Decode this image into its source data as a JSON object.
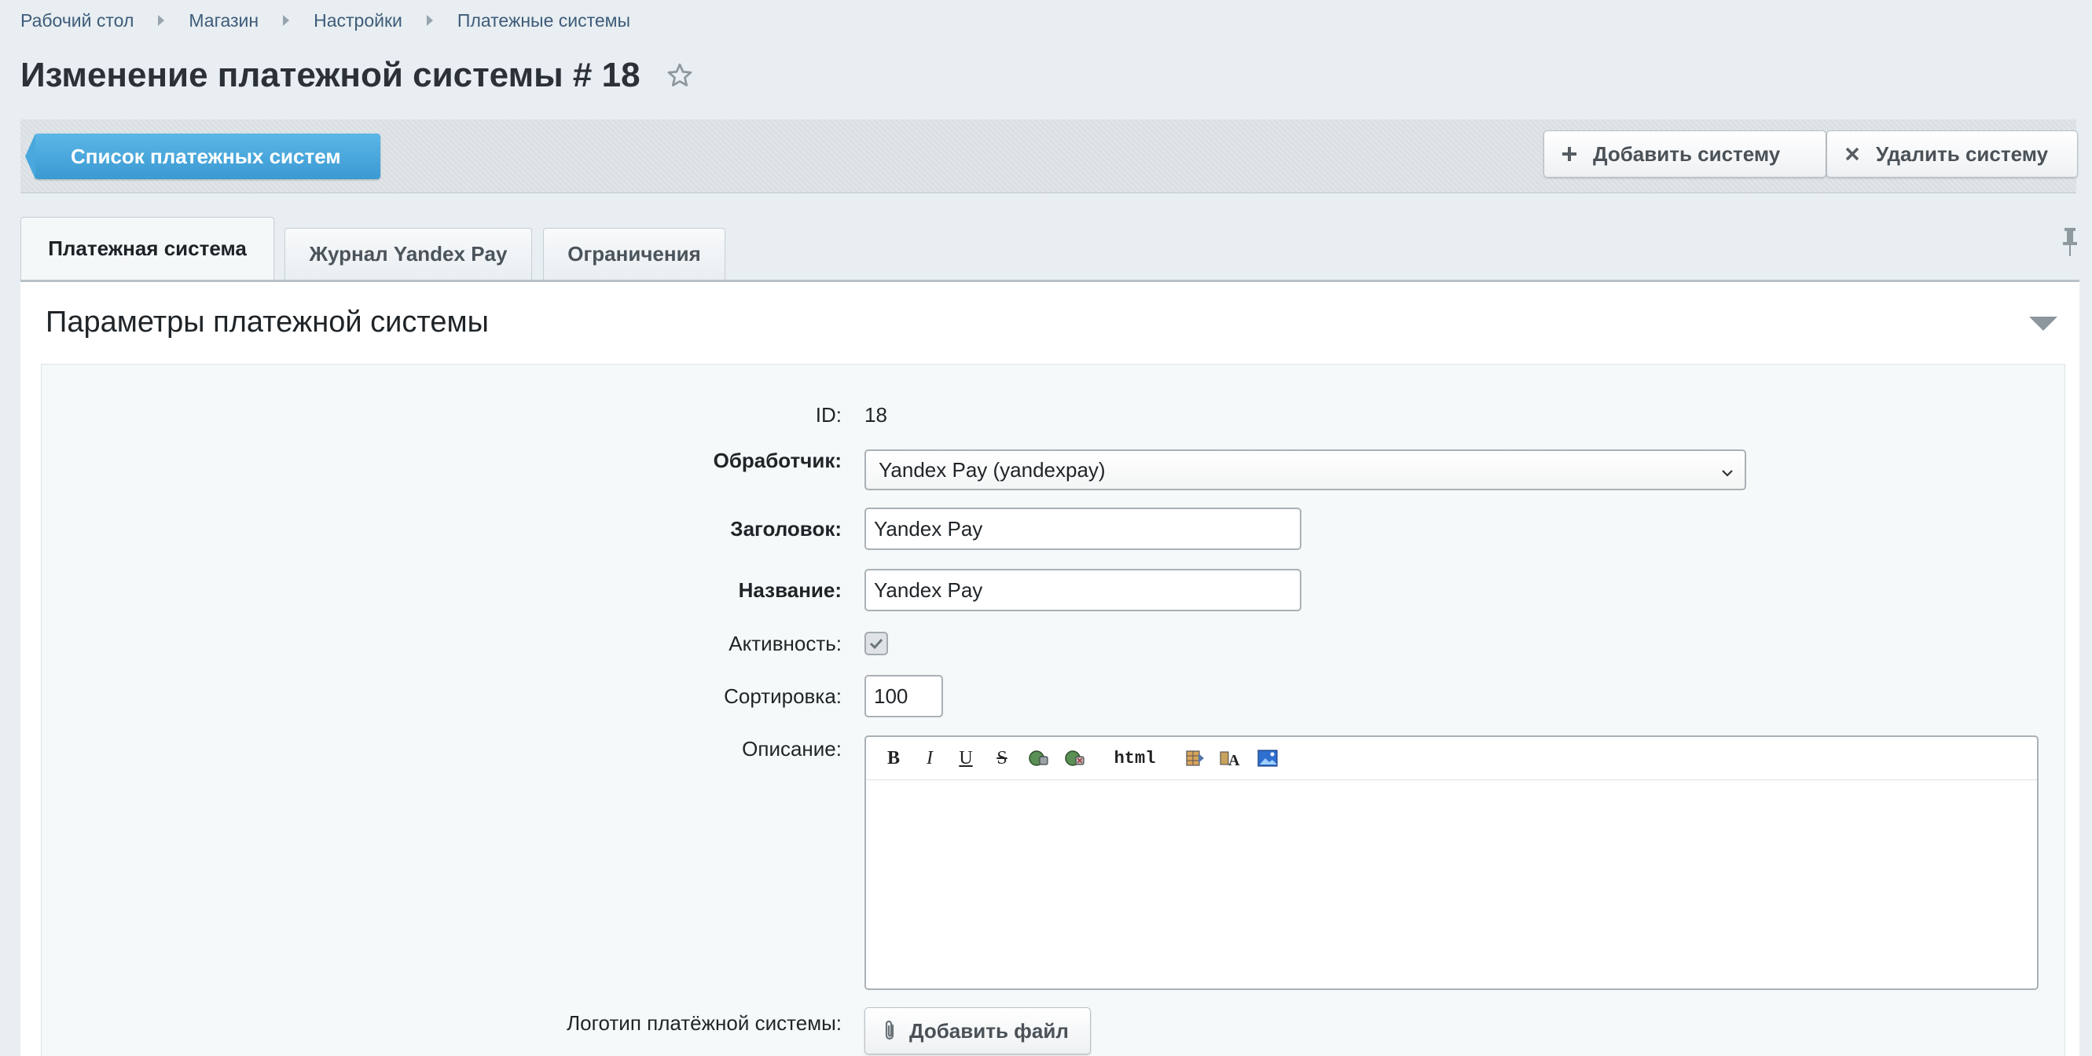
{
  "breadcrumb": [
    "Рабочий стол",
    "Магазин",
    "Настройки",
    "Платежные системы"
  ],
  "page_title": "Изменение платежной системы # 18",
  "toolbar": {
    "back_label": "Список платежных систем",
    "add_label": "Добавить систему",
    "delete_label": "Удалить систему"
  },
  "tabs": [
    {
      "label": "Платежная система",
      "active": true
    },
    {
      "label": "Журнал Yandex Pay",
      "active": false
    },
    {
      "label": "Ограничения",
      "active": false
    }
  ],
  "section": {
    "title": "Параметры платежной системы"
  },
  "form": {
    "id_label": "ID:",
    "id_value": "18",
    "handler_label": "Обработчик:",
    "handler_value": "Yandex Pay (yandexpay)",
    "header_label": "Заголовок:",
    "header_value": "Yandex Pay",
    "name_label": "Название:",
    "name_value": "Yandex Pay",
    "active_label": "Активность:",
    "active_checked": true,
    "sort_label": "Сортировка:",
    "sort_value": "100",
    "description_label": "Описание:",
    "editor_html_label": "html",
    "logo_label": "Логотип платёжной системы:",
    "add_file_label": "Добавить файл"
  },
  "colors": {
    "background": "#e8eef1",
    "primary_button": "#3b9ad2",
    "text": "#2b3137",
    "link": "#3d5b7a"
  }
}
